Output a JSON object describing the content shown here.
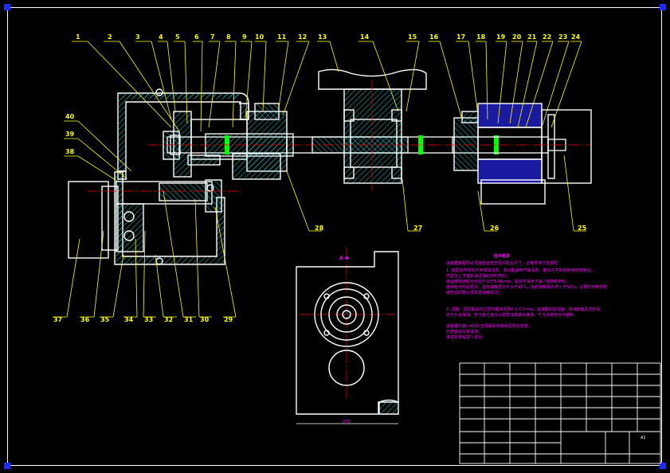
{
  "drawing": {
    "sheet_size": "A1",
    "section_title": "A-A",
    "base_dimension": "270",
    "tech_req_title": "技术要求",
    "tech_req_line_0": "减速器装配前必须按图纸检查零件配合尺寸，合格零件才能装配",
    "tech_req_line_1": "1. 装配前所有零件用煤油清洗，滚动轴承用汽油清洗，箱体内不许有任何杂物存在，",
    "tech_req_line_2": "   内壁涂上不被机油浸蚀的涂料两次；",
    "tech_req_line_3": "   啮合侧隙用铅丝检验不小于0.16mm，铅丝不得大于最小侧隙的4倍；",
    "tech_req_line_4": "   用涂色法检验斑点，齿高接触斑点不小于40%，齿长接触斑点不小于50%，必要时可用研磨",
    "tech_req_line_5": "   或刮后研磨以便改善接触情况；",
    "tech_req_line_6": "2. 调整、固定轴承时应留有轴向间隙0.2-0.5mm，减速器的剖分面、各接触面及密封处",
    "tech_req_line_7": "   均不允许漏油，剖分面允许涂以密封油漆或水玻璃，不允许使用任何填料；",
    "tech_req_line_8": "   减速器内装L-AN32全损耗系统用油至规定高度，",
    "tech_req_line_9": "   外表面涂灰色油漆。",
    "tech_req_line_10": "   按试验规程进行试验。"
  },
  "part_labels": {
    "p1": "1",
    "p2": "2",
    "p3": "3",
    "p4": "4",
    "p5": "5",
    "p6": "6",
    "p7": "7",
    "p8": "8",
    "p9": "9",
    "p10": "10",
    "p11": "11",
    "p12": "12",
    "p13": "13",
    "p14": "14",
    "p15": "15",
    "p16": "16",
    "p17": "17",
    "p18": "18",
    "p19": "19",
    "p20": "20",
    "p21": "21",
    "p22": "22",
    "p23": "23",
    "p24": "24",
    "p25": "25",
    "p26": "26",
    "p27": "27",
    "p28": "28",
    "p29": "29",
    "p30": "30",
    "p31": "31",
    "p32": "32",
    "p33": "33",
    "p34": "34",
    "p35": "35",
    "p36": "36",
    "p37": "37",
    "p38": "38",
    "p39": "39",
    "p40": "40"
  },
  "colors": {
    "background": "#000000",
    "outline": "#ffffff",
    "leader": "#ffff00",
    "hatch": "#00ffff",
    "center_line": "#ff0000",
    "annotation": "#ff00ff",
    "frame_corner": "#1c2bff",
    "section_fill": "#1a1aa0",
    "seal_mark": "#00ff00"
  }
}
